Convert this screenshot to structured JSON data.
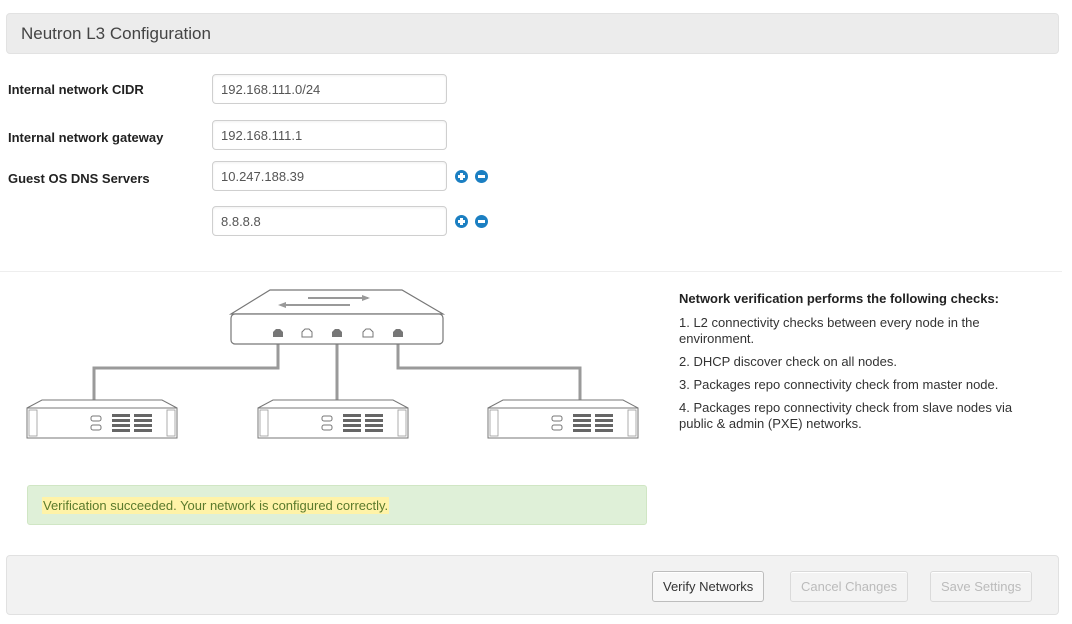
{
  "section": {
    "title": "Neutron L3 Configuration"
  },
  "form": {
    "cidr": {
      "label": "Internal network CIDR",
      "value": "192.168.111.0/24"
    },
    "gateway": {
      "label": "Internal network gateway",
      "value": "192.168.111.1"
    },
    "dns": {
      "label": "Guest OS DNS Servers",
      "values": [
        "10.247.188.39",
        "8.8.8.8"
      ]
    }
  },
  "verification_info": {
    "title": "Network verification performs the following checks:",
    "checks": [
      "1. L2 connectivity checks between every node in the environment.",
      "2. DHCP discover check on all nodes.",
      "3. Packages repo connectivity check from master node.",
      "4. Packages repo connectivity check from slave nodes via public & admin (PXE) networks."
    ]
  },
  "alert": {
    "text": "Verification succeeded. Your network is configured correctly."
  },
  "footer": {
    "verify_label": "Verify Networks",
    "cancel_label": "Cancel Changes",
    "save_label": "Save Settings"
  },
  "colors": {
    "accent": "#1b7fc2",
    "success_bg": "#dff0d8",
    "success_text": "#5a7a2c",
    "header_bg": "#ececec"
  },
  "icons": {
    "dns_add": "plus-circle-icon",
    "dns_remove": "minus-circle-icon"
  }
}
